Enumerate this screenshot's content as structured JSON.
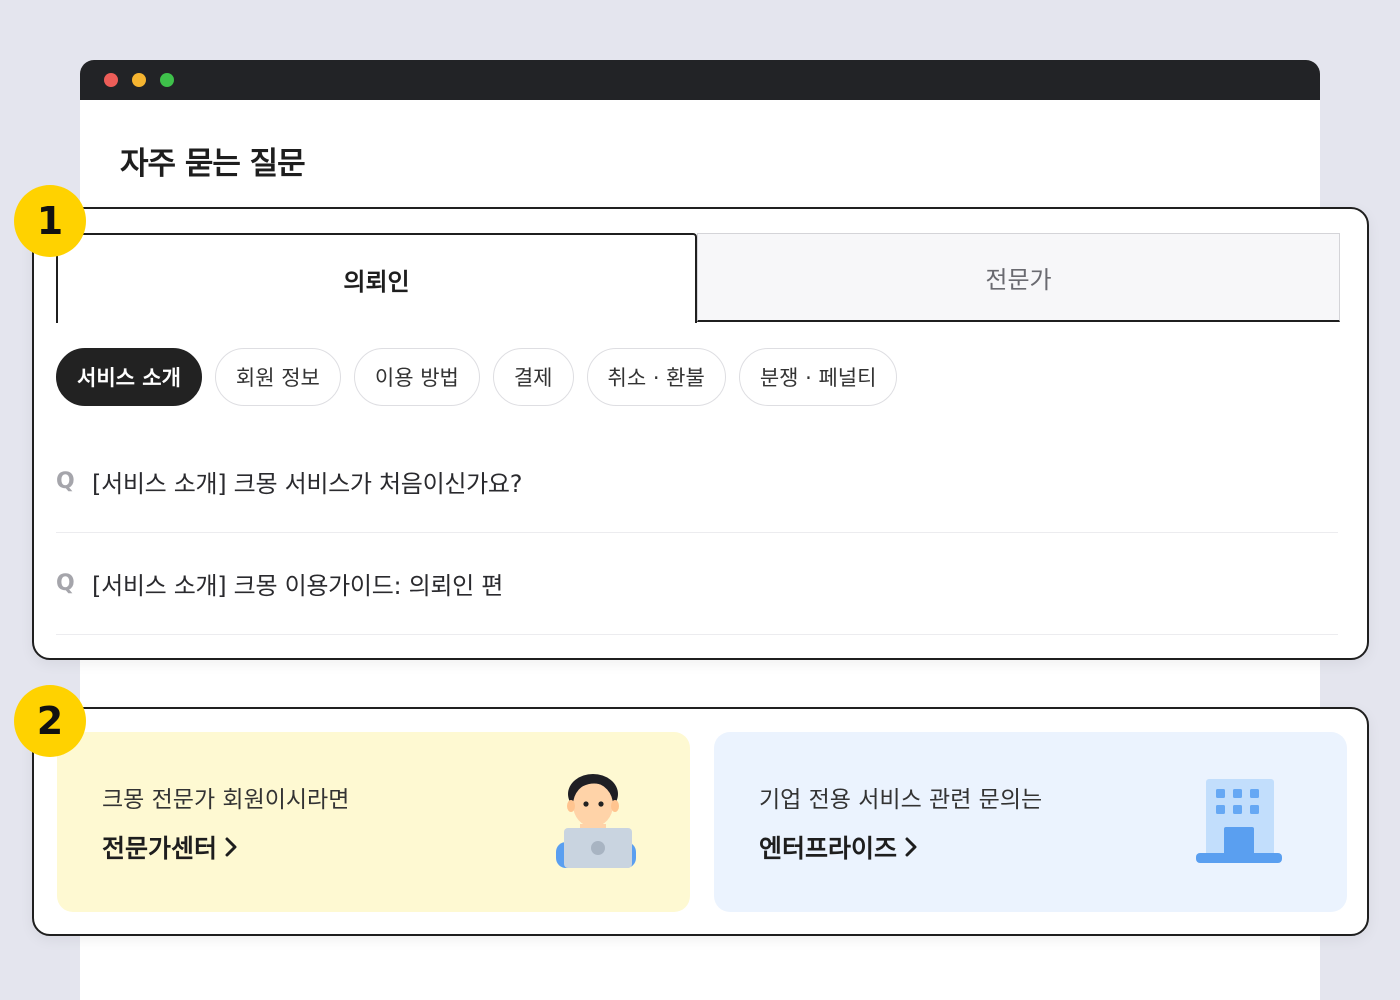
{
  "page": {
    "title": "자주 묻는 질문"
  },
  "markers": [
    "1",
    "2"
  ],
  "tabs": {
    "active_label": "의뢰인",
    "inactive_label": "전문가"
  },
  "categories": [
    {
      "label": "서비스 소개",
      "selected": true
    },
    {
      "label": "회원 정보",
      "selected": false
    },
    {
      "label": "이용 방법",
      "selected": false
    },
    {
      "label": "결제",
      "selected": false
    },
    {
      "label": "취소 · 환불",
      "selected": false
    },
    {
      "label": "분쟁 · 페널티",
      "selected": false
    }
  ],
  "faq": [
    {
      "icon": "Q",
      "text": "[서비스 소개] 크몽 서비스가 처음이신가요?"
    },
    {
      "icon": "Q",
      "text": "[서비스 소개] 크몽 이용가이드: 의뢰인 편"
    }
  ],
  "cards": {
    "expert": {
      "subtitle": "크몽 전문가 회원이시라면",
      "link": "전문가센터",
      "icon": "person-laptop-icon",
      "bg": "#fef9d2"
    },
    "enterprise": {
      "subtitle": "기업 전용 서비스 관련 문의는",
      "link": "엔터프라이즈",
      "icon": "building-icon",
      "bg": "#ebf3fe"
    }
  },
  "colors": {
    "marker": "#ffd200",
    "titlebar": "#222326",
    "selected_chip": "#222222"
  }
}
